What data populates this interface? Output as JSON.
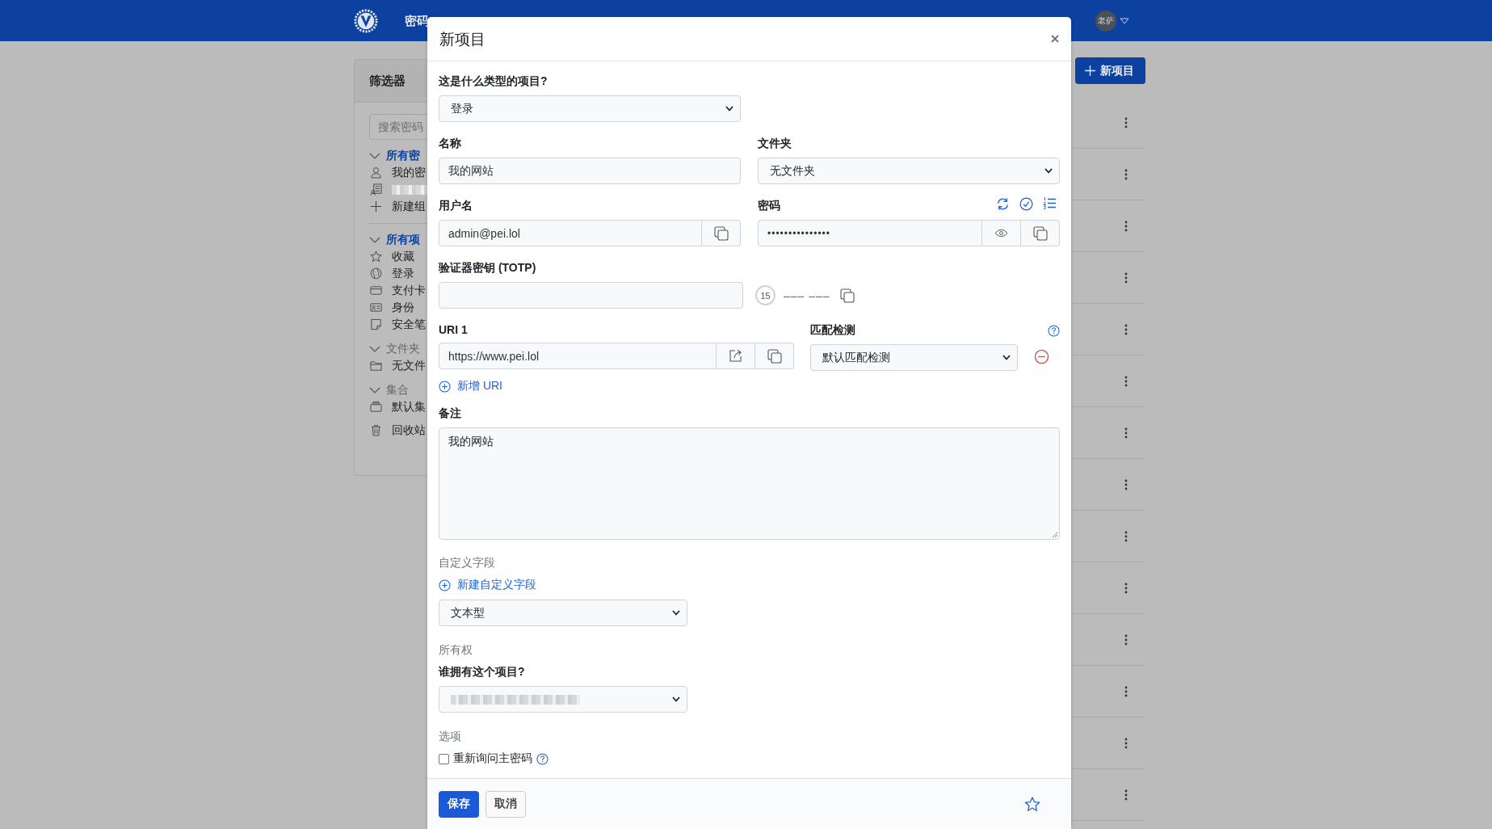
{
  "navbar": {
    "nav_items": [
      "密码"
    ],
    "avatar": "老萨"
  },
  "sidebar": {
    "title": "筛选器",
    "search": {
      "placeholder": "搜索密码"
    },
    "groups": [
      {
        "heading": "所有密",
        "expanded": true,
        "selected": true,
        "children": [
          {
            "kind": "person",
            "label": "我的密"
          },
          {
            "kind": "organization"
          },
          {
            "kind": "plus",
            "label": "新建组"
          }
        ]
      },
      {
        "heading": "所有项",
        "expanded": true,
        "selected": true,
        "children": [
          {
            "kind": "star",
            "label": "收藏"
          },
          {
            "kind": "globe",
            "label": "登录"
          },
          {
            "kind": "card",
            "label": "支付卡"
          },
          {
            "kind": "id",
            "label": "身份"
          },
          {
            "kind": "note",
            "label": "安全笔"
          }
        ]
      },
      {
        "heading": "文件夹",
        "expanded": true,
        "selected": false,
        "children": [
          {
            "kind": "folder",
            "label": "无文件"
          }
        ]
      },
      {
        "heading": "集合",
        "expanded": true,
        "selected": false,
        "children": [
          {
            "kind": "collection",
            "label": "默认集"
          }
        ]
      }
    ],
    "trash": {
      "kind": "trash",
      "label": "回收站"
    }
  },
  "main": {
    "new_item_button": "新项目"
  },
  "dialog": {
    "title": "新项目",
    "type_label": "这是什么类型的项目?",
    "type_value": "登录",
    "name": {
      "label": "名称",
      "value": "我的网站"
    },
    "folder": {
      "label": "文件夹",
      "value": "无文件夹"
    },
    "username": {
      "label": "用户名",
      "value": "admin@pei.lol"
    },
    "password": {
      "label": "密码",
      "value": "•••••••••••••••"
    },
    "totp": {
      "label": "验证器密钥 (TOTP)",
      "countdown": "15",
      "code": "––– –––"
    },
    "uris": [
      {
        "label": "URI 1",
        "value": "https://www.pei.lol",
        "match_label": "匹配检测",
        "match_value": "默认匹配检测"
      }
    ],
    "add_uri": "新增 URI",
    "notes": {
      "label": "备注",
      "value": "我的网站"
    },
    "custom_fields": {
      "heading": "自定义字段",
      "add_link": "新建自定义字段",
      "type_value": "文本型"
    },
    "ownership": {
      "heading": "所有权",
      "label": "谁拥有这个项目?"
    },
    "options": {
      "heading": "选项",
      "reprompt": {
        "label": "重新询问主密码",
        "checked": false
      }
    },
    "buttons": {
      "save": "保存",
      "cancel": "取消"
    },
    "favorite": false
  }
}
